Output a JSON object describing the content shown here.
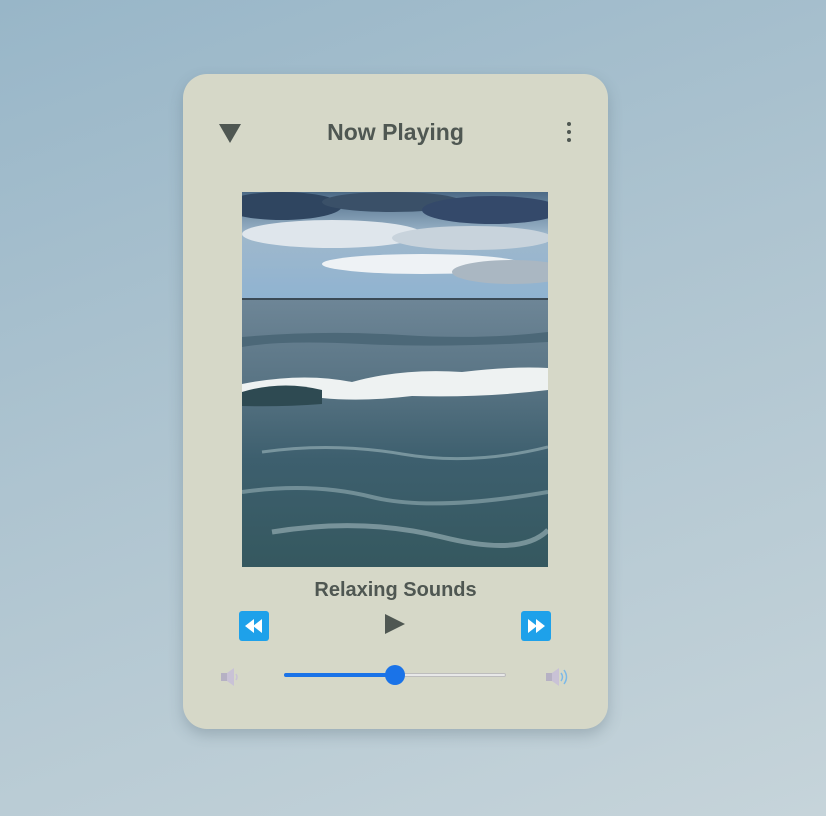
{
  "header": {
    "title": "Now Playing"
  },
  "track": {
    "title": "Relaxing Sounds"
  },
  "volume": {
    "level": 0.5
  },
  "icons": {
    "collapse": "triangle-down-icon",
    "menu": "more-vertical-icon",
    "rewind": "rewind-icon",
    "play": "play-icon",
    "forward": "fast-forward-icon",
    "volume_low": "volume-low-icon",
    "volume_high": "volume-high-icon"
  },
  "colors": {
    "card_background": "#d6d8c8",
    "text": "#4f5752",
    "control_button": "#1ea1ea",
    "slider_accent": "#1a73e8"
  }
}
